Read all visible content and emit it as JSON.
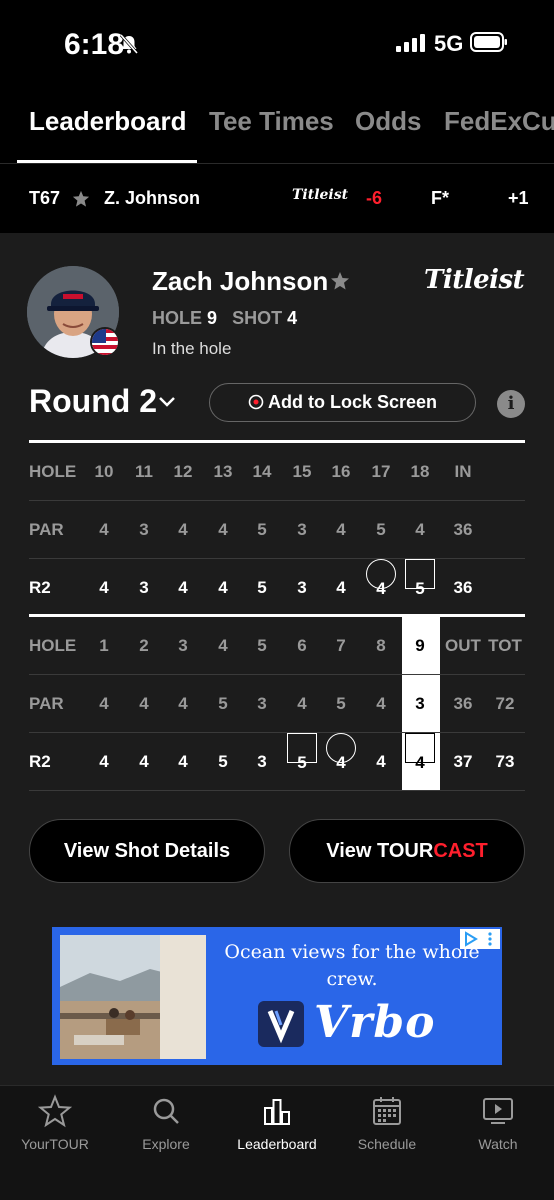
{
  "status_bar": {
    "time": "6:18",
    "network": "5G"
  },
  "tabs": [
    {
      "label": "Leaderboard",
      "active": true
    },
    {
      "label": "Tee Times",
      "active": false
    },
    {
      "label": "Odds",
      "active": false
    },
    {
      "label": "FedExCup",
      "active": false
    }
  ],
  "ticker": {
    "position": "T67",
    "player": "Z. Johnson",
    "sponsor": "Titleist",
    "to_par": "-6",
    "thru": "F*",
    "today": "+1"
  },
  "player": {
    "name": "Zach Johnson",
    "sponsor": "Titleist",
    "hole_label": "HOLE",
    "hole": "9",
    "shot_label": "SHOT",
    "shot": "4",
    "status": "In the hole"
  },
  "round": {
    "label": "Round 2",
    "lock_button": "Add to Lock Screen"
  },
  "back_nine": {
    "hole_label": "HOLE",
    "holes": [
      "10",
      "11",
      "12",
      "13",
      "14",
      "15",
      "16",
      "17",
      "18"
    ],
    "total_label": "IN",
    "par_label": "PAR",
    "par": [
      "4",
      "3",
      "4",
      "4",
      "5",
      "3",
      "4",
      "5",
      "4"
    ],
    "par_total": "36",
    "round_label": "R2",
    "scores": [
      "4",
      "3",
      "4",
      "4",
      "5",
      "3",
      "4",
      "4",
      "5"
    ],
    "score_total": "36"
  },
  "front_nine": {
    "hole_label": "HOLE",
    "holes": [
      "1",
      "2",
      "3",
      "4",
      "5",
      "6",
      "7",
      "8",
      "9"
    ],
    "out_label": "OUT",
    "tot_label": "TOT",
    "par_label": "PAR",
    "par": [
      "4",
      "4",
      "4",
      "5",
      "3",
      "4",
      "5",
      "4",
      "3"
    ],
    "par_out": "36",
    "par_tot": "72",
    "round_label": "R2",
    "scores": [
      "4",
      "4",
      "4",
      "5",
      "3",
      "5",
      "4",
      "4",
      "4"
    ],
    "score_out": "37",
    "score_tot": "73"
  },
  "buttons": {
    "shot_details": "View Shot Details",
    "tourcast_prefix": "View TOUR",
    "tourcast_suffix": "CAST"
  },
  "ad": {
    "headline": "Ocean views for the whole crew.",
    "brand": "Vrbo"
  },
  "bottom_nav": [
    {
      "label": "YourTOUR",
      "icon": "star-icon",
      "active": false
    },
    {
      "label": "Explore",
      "icon": "search-icon",
      "active": false
    },
    {
      "label": "Leaderboard",
      "icon": "leaderboard-icon",
      "active": true
    },
    {
      "label": "Schedule",
      "icon": "calendar-icon",
      "active": false
    },
    {
      "label": "Watch",
      "icon": "play-icon",
      "active": false
    }
  ],
  "colors": {
    "accent_red": "#ff1f2d",
    "card_bg": "#1c1c1c",
    "ad_blue": "#2a66e8"
  }
}
